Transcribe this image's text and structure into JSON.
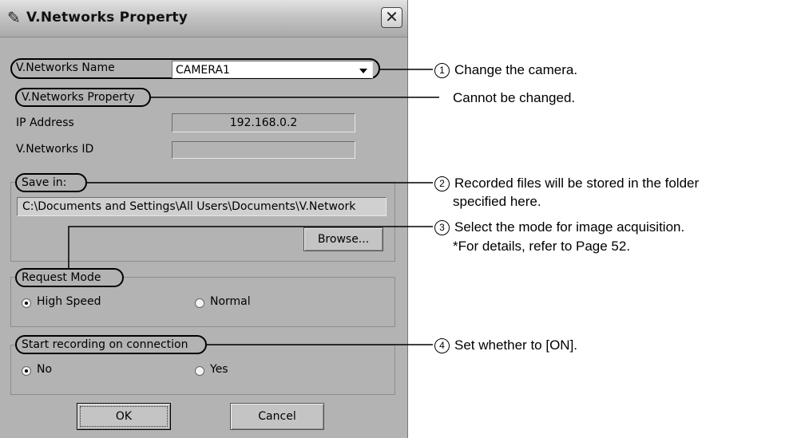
{
  "window": {
    "title": "V.Networks Property",
    "icon": "camera-app-icon",
    "close_icon": "close-icon"
  },
  "form": {
    "name_label": "V.Networks Name",
    "name_value": "CAMERA1",
    "property_label": "V.Networks Property",
    "ip_label": "IP Address",
    "ip_value": "192.168.0.2",
    "id_label": "V.Networks ID",
    "id_value": "",
    "save_label": "Save in:",
    "save_path": "C:\\Documents and Settings\\All Users\\Documents\\V.Network",
    "browse_label": "Browse...",
    "request_label": "Request Mode",
    "request_options": [
      "High Speed",
      "Normal"
    ],
    "request_selected": "High Speed",
    "start_label": "Start recording on connection",
    "start_options": [
      "No",
      "Yes"
    ],
    "start_selected": "No",
    "ok_label": "OK",
    "cancel_label": "Cancel"
  },
  "annotations": [
    {
      "number": "1",
      "text": "Change the camera."
    },
    {
      "number": "",
      "text": "Cannot be changed."
    },
    {
      "number": "2",
      "text": "Recorded files will be stored in the folder",
      "text2": "specified here."
    },
    {
      "number": "3",
      "text": "Select the mode for image acquisition.",
      "text2": "*For details, refer to Page 52."
    },
    {
      "number": "4",
      "text": "Set whether to [ON]."
    }
  ]
}
